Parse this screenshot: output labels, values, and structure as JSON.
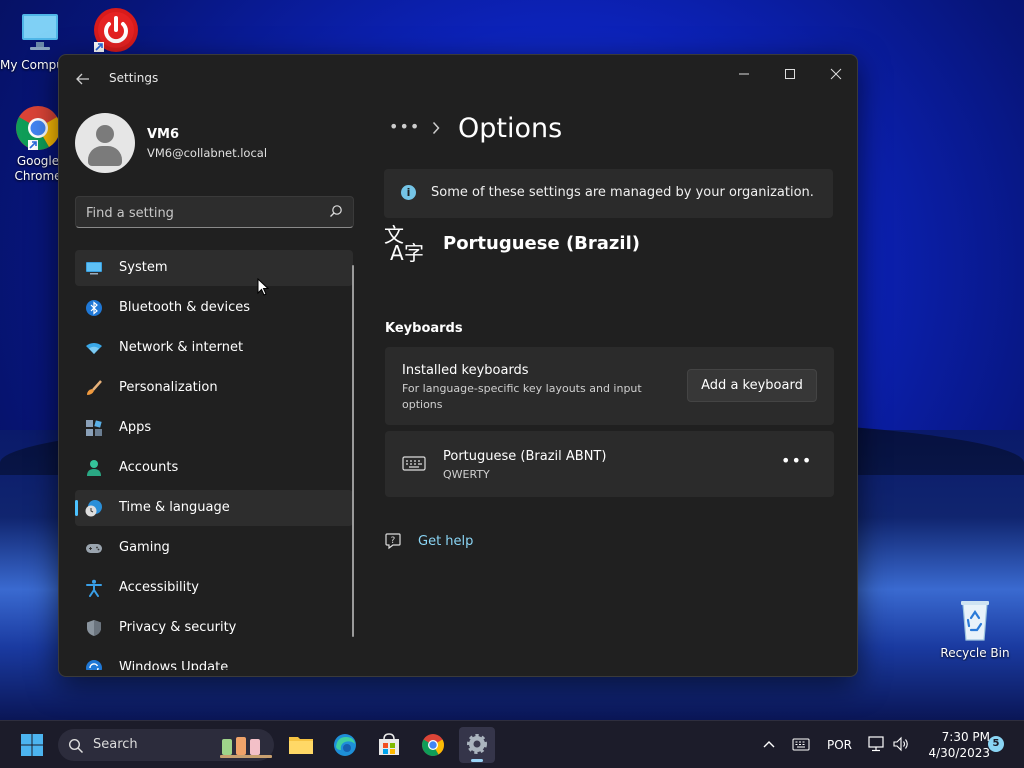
{
  "desktop": {
    "icons": [
      {
        "label": "My Computer"
      },
      {
        "label": ""
      },
      {
        "label": "Google Chrome"
      },
      {
        "label": "Recycle Bin"
      }
    ]
  },
  "window": {
    "title": "Settings",
    "controls": {
      "minimize": "—",
      "maximize": "☐",
      "close": "✕"
    }
  },
  "profile": {
    "name": "VM6",
    "email": "VM6@collabnet.local"
  },
  "search": {
    "placeholder": "Find a setting"
  },
  "nav": {
    "items": [
      {
        "label": "System",
        "icon": "system-icon"
      },
      {
        "label": "Bluetooth & devices",
        "icon": "bluetooth-icon"
      },
      {
        "label": "Network & internet",
        "icon": "wifi-icon"
      },
      {
        "label": "Personalization",
        "icon": "brush-icon"
      },
      {
        "label": "Apps",
        "icon": "apps-icon"
      },
      {
        "label": "Accounts",
        "icon": "accounts-icon"
      },
      {
        "label": "Time & language",
        "icon": "time-language-icon"
      },
      {
        "label": "Gaming",
        "icon": "gamepad-icon"
      },
      {
        "label": "Accessibility",
        "icon": "accessibility-icon"
      },
      {
        "label": "Privacy & security",
        "icon": "shield-icon"
      },
      {
        "label": "Windows Update",
        "icon": "update-icon"
      }
    ],
    "selected": "Time & language"
  },
  "main": {
    "breadcrumb_more": "•••",
    "title": "Options",
    "org_banner": "Some of these settings are managed by your organization.",
    "language": "Portuguese (Brazil)",
    "keyboards_heading": "Keyboards",
    "installed": {
      "title": "Installed keyboards",
      "description": "For language-specific key layouts and input options",
      "add_button": "Add a keyboard"
    },
    "keyboard_item": {
      "name": "Portuguese (Brazil ABNT)",
      "layout": "QWERTY",
      "more": "•••"
    },
    "help_link": "Get help"
  },
  "taskbar": {
    "search_label": "Search",
    "language_indicator": "POR",
    "time": "7:30 PM",
    "date": "4/30/2023",
    "notification_count": "5"
  },
  "colors": {
    "accent": "#4cc2ff",
    "link": "#8ad5f5",
    "window_bg": "#202020",
    "card_bg": "#2b2b2b"
  }
}
